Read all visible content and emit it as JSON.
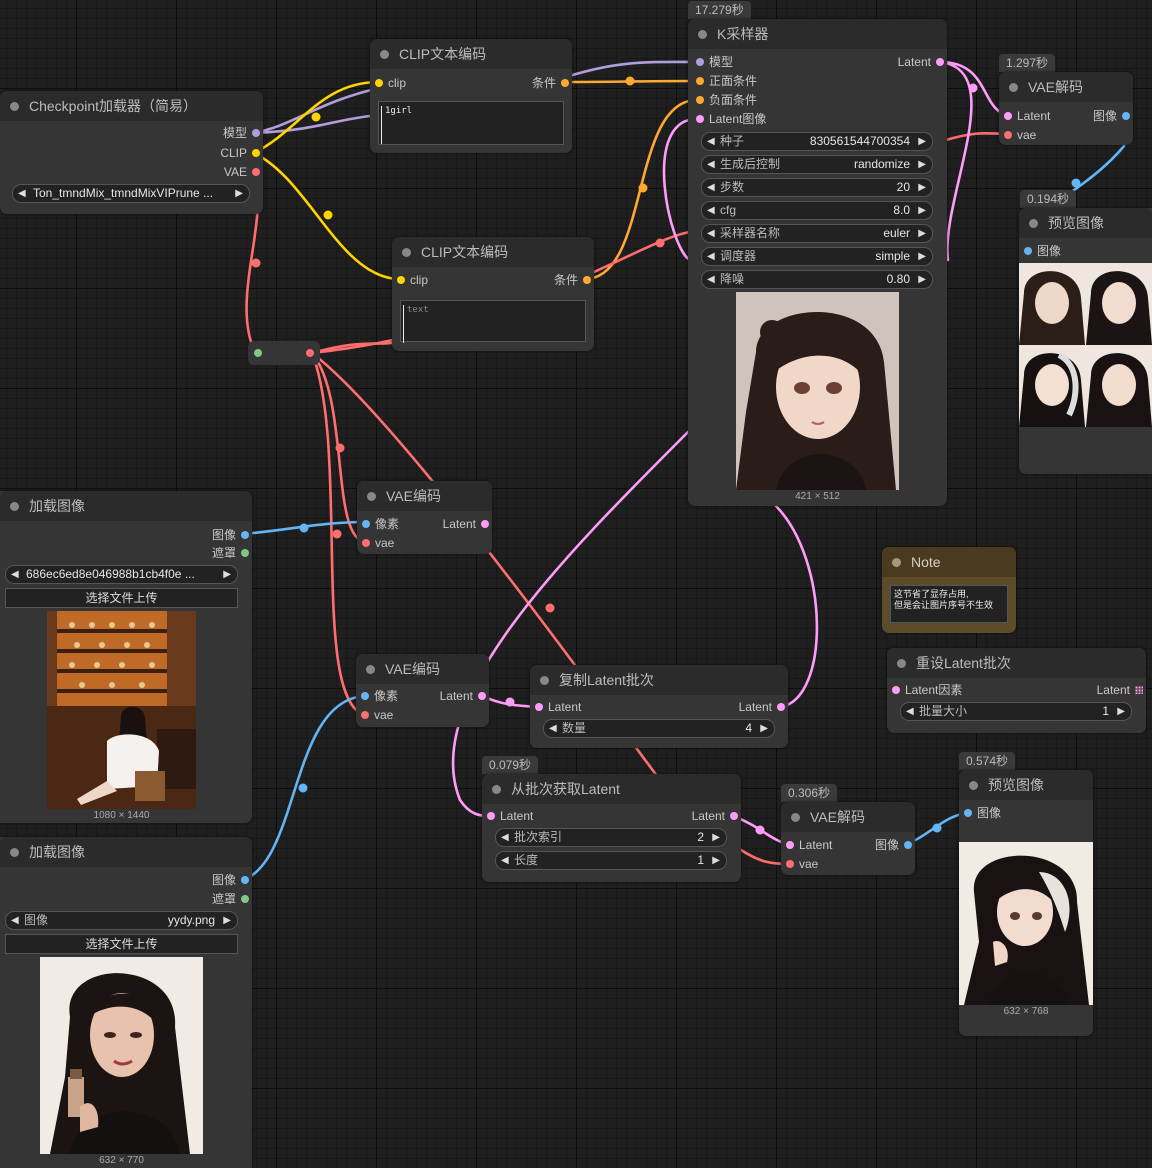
{
  "colors": {
    "model": "#b39ddb",
    "clip": "#ffd500",
    "vae": "#ff6e6e",
    "conditioning": "#ffa931",
    "latent": "#ff9cf9",
    "image": "#64b5f6",
    "mask": "#81c784"
  },
  "checkpoint": {
    "title": "Checkpoint加载器（简易）",
    "out_model": "模型",
    "out_clip": "CLIP",
    "out_vae": "VAE",
    "ckpt": "Ton_tmndMix_tmndMixVIPrune ..."
  },
  "clip1": {
    "title": "CLIP文本编码",
    "in_clip": "clip",
    "out_cond": "条件",
    "text": "1girl"
  },
  "clip2": {
    "title": "CLIP文本编码",
    "in_clip": "clip",
    "out_cond": "条件",
    "placeholder": "text"
  },
  "ksampler": {
    "time": "17.279秒",
    "title": "K采样器",
    "in_model": "模型",
    "in_pos": "正面条件",
    "in_neg": "负面条件",
    "in_latent": "Latent图像",
    "out_latent": "Latent",
    "widgets": [
      {
        "label": "种子",
        "value": "830561544700354"
      },
      {
        "label": "生成后控制",
        "value": "randomize"
      },
      {
        "label": "步数",
        "value": "20"
      },
      {
        "label": "cfg",
        "value": "8.0"
      },
      {
        "label": "采样器名称",
        "value": "euler"
      },
      {
        "label": "调度器",
        "value": "simple"
      },
      {
        "label": "降噪",
        "value": "0.80"
      }
    ],
    "dims": "421 × 512"
  },
  "vaedecode1": {
    "time": "1.297秒",
    "title": "VAE解码",
    "in_latent": "Latent",
    "in_vae": "vae",
    "out_image": "图像"
  },
  "preview1": {
    "time": "0.194秒",
    "title": "预览图像",
    "in_image": "图像"
  },
  "loadimg1": {
    "title": "加载图像",
    "out_image": "图像",
    "out_mask": "遮罩",
    "file": "686ec6ed8e046988b1cb4f0e ...",
    "upload": "选择文件上传",
    "dims": "1080 × 1440"
  },
  "loadimg2": {
    "title": "加载图像",
    "out_image": "图像",
    "out_mask": "遮罩",
    "file_label": "图像",
    "file": "yydy.png",
    "upload": "选择文件上传",
    "dims": "632 × 770"
  },
  "vaeenc1": {
    "title": "VAE编码",
    "in_pixels": "像素",
    "in_vae": "vae",
    "out_latent": "Latent"
  },
  "vaeenc2": {
    "title": "VAE编码",
    "in_pixels": "像素",
    "in_vae": "vae",
    "out_latent": "Latent"
  },
  "repeat": {
    "title": "复制Latent批次",
    "in_samples": "Latent",
    "out_latent": "Latent",
    "amount_label": "数量",
    "amount": "4"
  },
  "frombatch": {
    "time": "0.079秒",
    "title": "从批次获取Latent",
    "in_samples": "Latent",
    "out_latent": "Latent",
    "index_label": "批次索引",
    "index": "2",
    "length_label": "长度",
    "length": "1"
  },
  "vaedecode2": {
    "time": "0.306秒",
    "title": "VAE解码",
    "in_latent": "Latent",
    "in_vae": "vae",
    "out_image": "图像"
  },
  "preview2": {
    "time": "0.574秒",
    "title": "预览图像",
    "in_image": "图像",
    "dims": "632 × 768"
  },
  "note": {
    "title": "Note",
    "line1": "这节省了显存占用,",
    "line2": "但是会让图片序号不生效"
  },
  "rebatch": {
    "title": "重设Latent批次",
    "in_latents": "Latent因素",
    "out_latent": "Latent",
    "size_label": "批量大小",
    "size": "1"
  }
}
